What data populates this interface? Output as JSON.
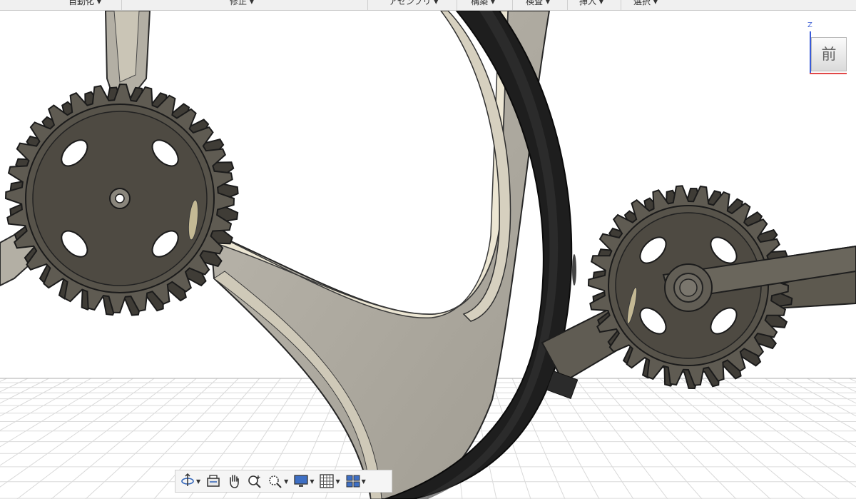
{
  "toolbar": {
    "groups": [
      {
        "label": "自動化",
        "has_dropdown": true
      },
      {
        "label": "修正",
        "has_dropdown": true
      },
      {
        "label": "アセンブリ",
        "has_dropdown": true
      },
      {
        "label": "構築",
        "has_dropdown": true
      },
      {
        "label": "検査",
        "has_dropdown": true
      },
      {
        "label": "挿入",
        "has_dropdown": true
      },
      {
        "label": "選択",
        "has_dropdown": true
      }
    ]
  },
  "viewcube": {
    "face_label": "前",
    "axis_label": "Z"
  },
  "navigation_bar": {
    "tools": [
      {
        "icon": "orbit-icon",
        "has_dropdown": true
      },
      {
        "icon": "look-at-icon",
        "has_dropdown": false
      },
      {
        "icon": "pan-hand-icon",
        "has_dropdown": false
      },
      {
        "icon": "zoom-icon",
        "has_dropdown": false
      },
      {
        "icon": "zoom-window-icon",
        "has_dropdown": true
      },
      {
        "icon": "display-settings-icon",
        "has_dropdown": true
      },
      {
        "icon": "grid-settings-icon",
        "has_dropdown": true
      },
      {
        "icon": "viewports-icon",
        "has_dropdown": true
      }
    ]
  },
  "scene": {
    "description_colors": {
      "frame": "#a9a59b",
      "frame_inner": "#e7e1cf",
      "gear": "#5f5b52",
      "tire": "#1c1c1c",
      "grid": "#dcdcdc"
    }
  }
}
